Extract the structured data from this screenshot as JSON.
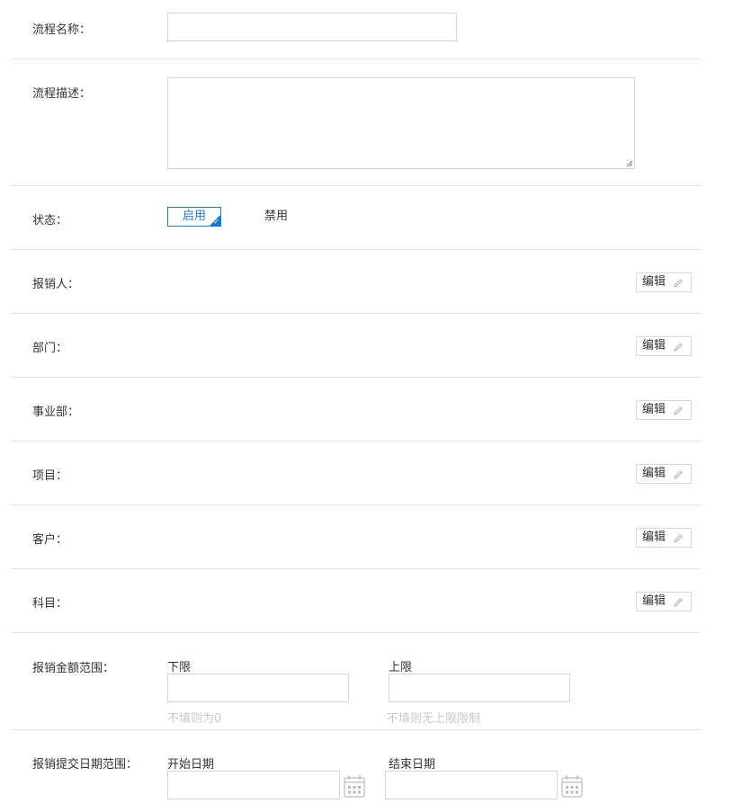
{
  "form": {
    "process_name_label": "流程名称：",
    "process_desc_label": "流程描述：",
    "status": {
      "label": "状态：",
      "options": [
        "启用",
        "禁用"
      ],
      "selected": "启用"
    },
    "edit_label": "编辑",
    "edit_rows": [
      {
        "label": "报销人：",
        "name": "reimburser"
      },
      {
        "label": "部门：",
        "name": "department"
      },
      {
        "label": "事业部：",
        "name": "division"
      },
      {
        "label": "项目：",
        "name": "project"
      },
      {
        "label": "客户：",
        "name": "customer"
      },
      {
        "label": "科目：",
        "name": "subject"
      }
    ],
    "amount_range": {
      "label": "报销金额范围：",
      "lower_label": "下限",
      "lower_hint": "不填则为0",
      "upper_label": "上限",
      "upper_hint": "不填则无上限限制"
    },
    "date_range": {
      "label": "报销提交日期范围：",
      "start_label": "开始日期",
      "end_label": "结束日期"
    }
  },
  "colors": {
    "accent": "#1a7bd6",
    "border": "#d4d4d4",
    "divider": "#e4e4e4",
    "hint": "#c8c8c8",
    "text": "#333333"
  }
}
